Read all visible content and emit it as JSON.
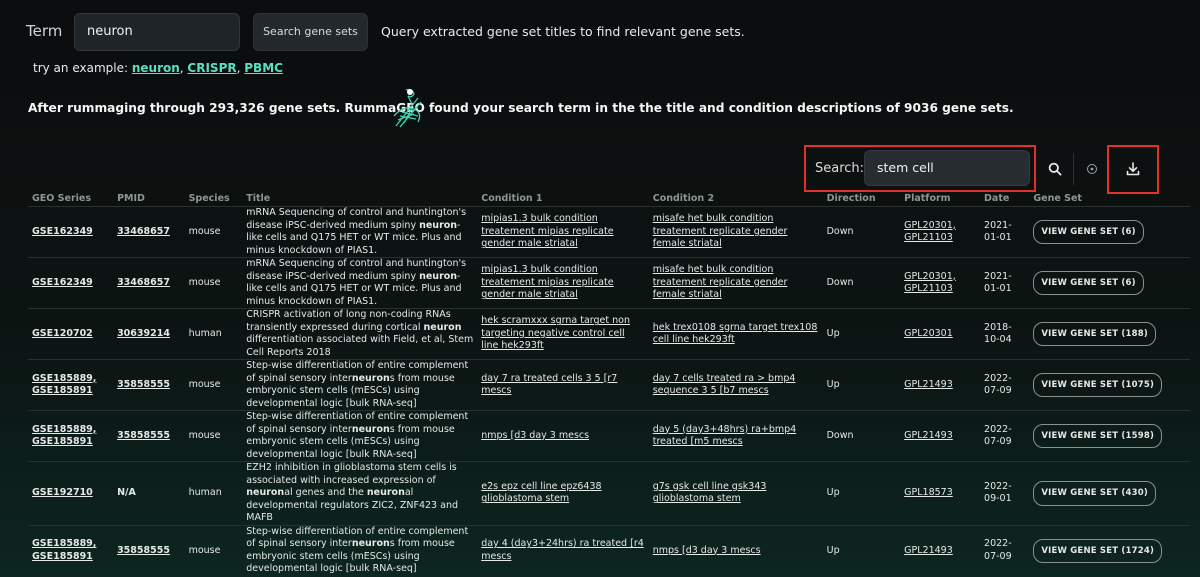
{
  "top": {
    "term_label": "Term",
    "term_value": "neuron",
    "search_button": "Search gene sets",
    "query_text": "Query extracted gene set titles to find relevant gene sets.",
    "try_prefix": "try an example: ",
    "examples": [
      "neuron",
      "CRISPR",
      "PBMC"
    ]
  },
  "summary": {
    "before": "After rummaging through 293,326 gene sets. RummaGEO",
    "after": "found your search term in the the title and condition descriptions of 9036 gene sets."
  },
  "table_search": {
    "label": "Search:",
    "value": "stem cell"
  },
  "icons": {
    "search": "search-icon",
    "clear": "clear-icon",
    "download": "download-icon"
  },
  "table": {
    "headers": [
      "GEO Series",
      "PMID",
      "Species",
      "Title",
      "Condition 1",
      "Condition 2",
      "Direction",
      "Platform",
      "Date",
      "Gene Set"
    ],
    "rows": [
      {
        "geo": [
          "GSE162349"
        ],
        "pmid": "33468657",
        "species": "mouse",
        "title": [
          [
            "mRNA Sequencing of control and huntington's disease iPSC-derived medium spiny ",
            false
          ],
          [
            "neuron",
            true
          ],
          [
            "-like cells and Q175 HET or WT mice. Plus and minus knockdown of PIAS1.",
            false
          ]
        ],
        "cond1": "mipias1.3 bulk condition treatement mipias replicate gender male striatal",
        "cond2": "misafe het bulk condition treatement replicate gender female striatal",
        "direction": "Down",
        "platform": [
          "GPL20301,",
          "GPL21103"
        ],
        "date": [
          "2021-",
          "01-01"
        ],
        "gene_set": "VIEW GENE SET (6)"
      },
      {
        "geo": [
          "GSE162349"
        ],
        "pmid": "33468657",
        "species": "mouse",
        "title": [
          [
            "mRNA Sequencing of control and huntington's disease iPSC-derived medium spiny ",
            false
          ],
          [
            "neuron",
            true
          ],
          [
            "-like cells and Q175 HET or WT mice. Plus and minus knockdown of PIAS1.",
            false
          ]
        ],
        "cond1": "mipias1.3 bulk condition treatement mipias replicate gender male striatal",
        "cond2": "misafe het bulk condition treatement replicate gender female striatal",
        "direction": "Down",
        "platform": [
          "GPL20301,",
          "GPL21103"
        ],
        "date": [
          "2021-",
          "01-01"
        ],
        "gene_set": "VIEW GENE SET (6)"
      },
      {
        "geo": [
          "GSE120702"
        ],
        "pmid": "30639214",
        "species": "human",
        "title": [
          [
            "CRISPR activation of long non-coding RNAs transiently expressed during cortical ",
            false
          ],
          [
            "neuron",
            true
          ],
          [
            " differentiation associated with Field, et al, Stem Cell Reports 2018",
            false
          ]
        ],
        "cond1": "hek scramxxx sgrna target non targeting negative control cell line hek293ft",
        "cond2": "hek trex0108 sgrna target trex108 cell line hek293ft",
        "direction": "Up",
        "platform": [
          "GPL20301"
        ],
        "date": [
          "2018-",
          "10-04"
        ],
        "gene_set": "VIEW GENE SET (188)"
      },
      {
        "geo": [
          "GSE185889,",
          "GSE185891"
        ],
        "pmid": "35858555",
        "species": "mouse",
        "title": [
          [
            "Step-wise differentiation of entire complement of spinal sensory inter",
            false
          ],
          [
            "neuron",
            true
          ],
          [
            "s from mouse embryonic stem cells (mESCs) using developmental logic [bulk RNA-seq]",
            false
          ]
        ],
        "cond1": "day 7 ra treated cells 3 5 [r7 mescs",
        "cond2": "day 7 cells treated ra > bmp4 sequence 3 5 [b7 mescs",
        "direction": "Up",
        "platform": [
          "GPL21493"
        ],
        "date": [
          "2022-",
          "07-09"
        ],
        "gene_set": "VIEW GENE SET (1075)"
      },
      {
        "geo": [
          "GSE185889,",
          "GSE185891"
        ],
        "pmid": "35858555",
        "species": "mouse",
        "title": [
          [
            "Step-wise differentiation of entire complement of spinal sensory inter",
            false
          ],
          [
            "neuron",
            true
          ],
          [
            "s from mouse embryonic stem cells (mESCs) using developmental logic [bulk RNA-seq]",
            false
          ]
        ],
        "cond1": "nmps [d3 day 3 mescs",
        "cond2": "day 5 (day3+48hrs) ra+bmp4 treated [m5 mescs",
        "direction": "Down",
        "platform": [
          "GPL21493"
        ],
        "date": [
          "2022-",
          "07-09"
        ],
        "gene_set": "VIEW GENE SET (1598)"
      },
      {
        "geo": [
          "GSE192710"
        ],
        "pmid": "N/A",
        "species": "human",
        "title": [
          [
            "EZH2 inhibition in glioblastoma stem cells is associated with increased expression of ",
            false
          ],
          [
            "neuron",
            true
          ],
          [
            "al genes and the ",
            false
          ],
          [
            "neuron",
            true
          ],
          [
            "al developmental regulators ZIC2, ZNF423 and MAFB",
            false
          ]
        ],
        "cond1": "e2s epz cell line epz6438 glioblastoma stem",
        "cond2": "g7s gsk cell line gsk343 glioblastoma stem",
        "direction": "Up",
        "platform": [
          "GPL18573"
        ],
        "date": [
          "2022-",
          "09-01"
        ],
        "gene_set": "VIEW GENE SET (430)"
      },
      {
        "geo": [
          "GSE185889,",
          "GSE185891"
        ],
        "pmid": "35858555",
        "species": "mouse",
        "title": [
          [
            "Step-wise differentiation of entire complement of spinal sensory inter",
            false
          ],
          [
            "neuron",
            true
          ],
          [
            "s from mouse embryonic stem cells (mESCs) using developmental logic [bulk RNA-seq]",
            false
          ]
        ],
        "cond1": "day 4 (day3+24hrs) ra treated [r4 mescs",
        "cond2": "nmps [d3 day 3 mescs",
        "direction": "Up",
        "platform": [
          "GPL21493"
        ],
        "date": [
          "2022-",
          "07-09"
        ],
        "gene_set": "VIEW GENE SET (1724)"
      }
    ]
  }
}
